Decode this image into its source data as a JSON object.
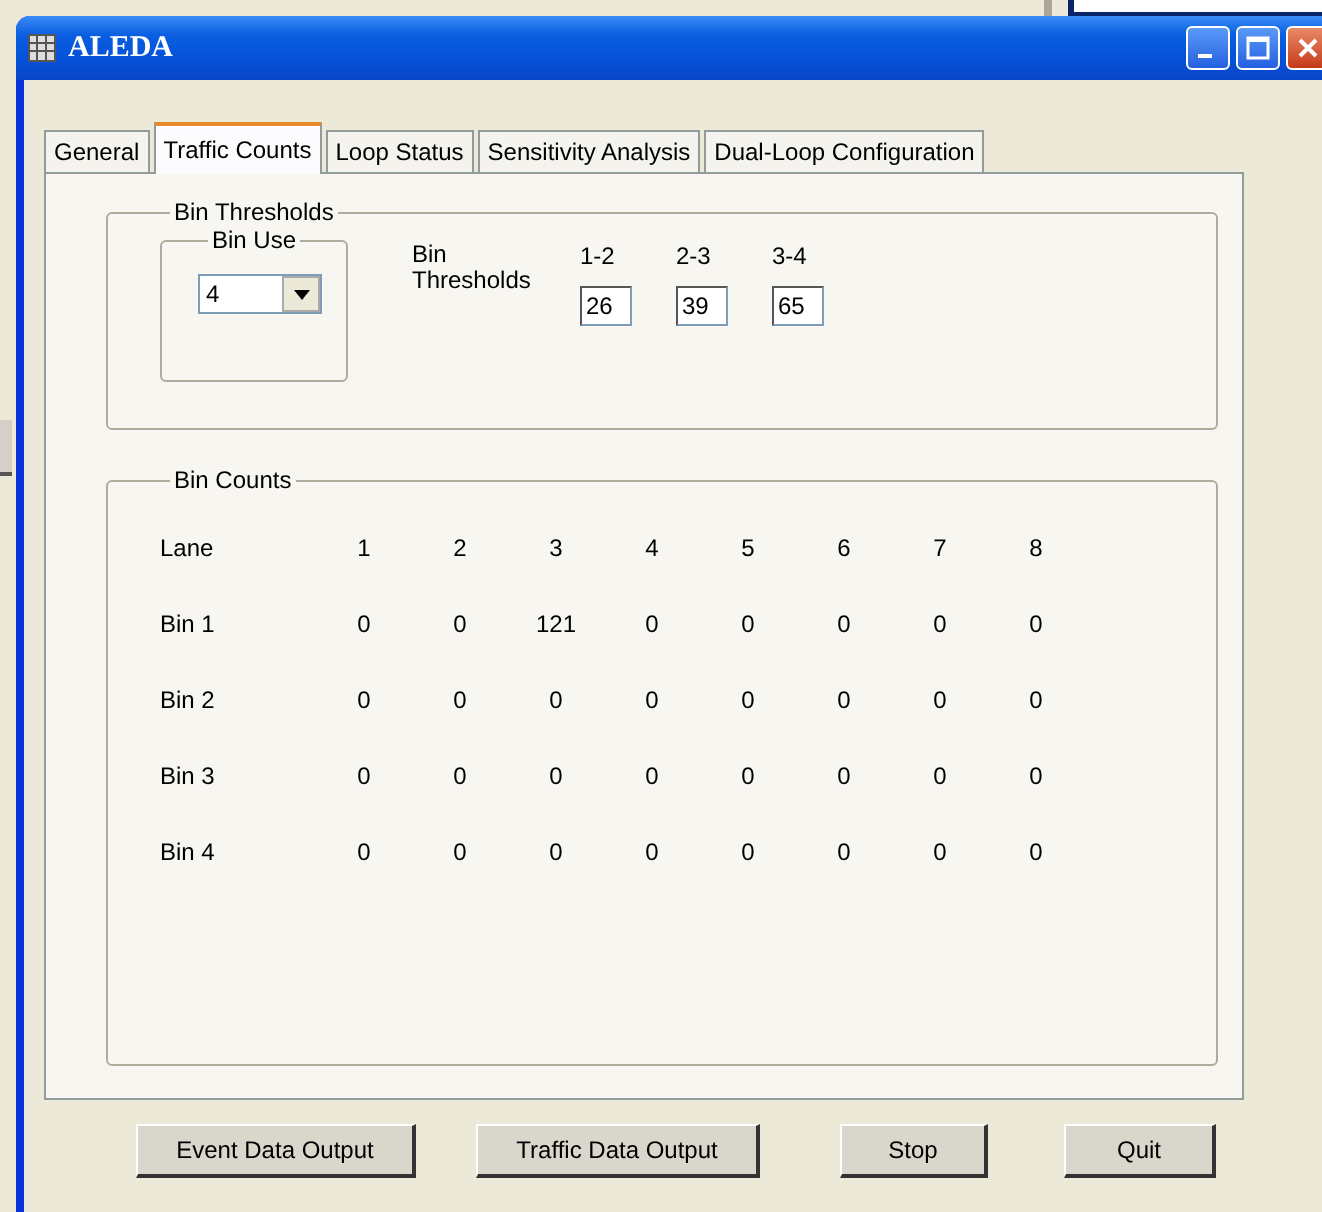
{
  "window": {
    "title": "ALEDA"
  },
  "tabs": [
    {
      "label": "General",
      "selected": false
    },
    {
      "label": "Traffic Counts",
      "selected": true
    },
    {
      "label": "Loop Status",
      "selected": false
    },
    {
      "label": "Sensitivity Analysis",
      "selected": false
    },
    {
      "label": "Dual-Loop Configuration",
      "selected": false
    }
  ],
  "bin_thresholds": {
    "title": "Bin Thresholds",
    "bin_use": {
      "title": "Bin Use",
      "value": "4"
    },
    "label": "Bin Thresholds",
    "thresholds": [
      {
        "header": "1-2",
        "value": "26"
      },
      {
        "header": "2-3",
        "value": "39"
      },
      {
        "header": "3-4",
        "value": "65"
      }
    ]
  },
  "bin_counts": {
    "title": "Bin Counts",
    "header": [
      "Lane",
      "1",
      "2",
      "3",
      "4",
      "5",
      "6",
      "7",
      "8"
    ],
    "rows": [
      {
        "label": "Bin 1",
        "values": [
          "0",
          "0",
          "121",
          "0",
          "0",
          "0",
          "0",
          "0"
        ]
      },
      {
        "label": "Bin 2",
        "values": [
          "0",
          "0",
          "0",
          "0",
          "0",
          "0",
          "0",
          "0"
        ]
      },
      {
        "label": "Bin 3",
        "values": [
          "0",
          "0",
          "0",
          "0",
          "0",
          "0",
          "0",
          "0"
        ]
      },
      {
        "label": "Bin 4",
        "values": [
          "0",
          "0",
          "0",
          "0",
          "0",
          "0",
          "0",
          "0"
        ]
      }
    ]
  },
  "buttons": [
    "Event Data Output",
    "Traffic Data Output",
    "Stop",
    "Quit"
  ]
}
